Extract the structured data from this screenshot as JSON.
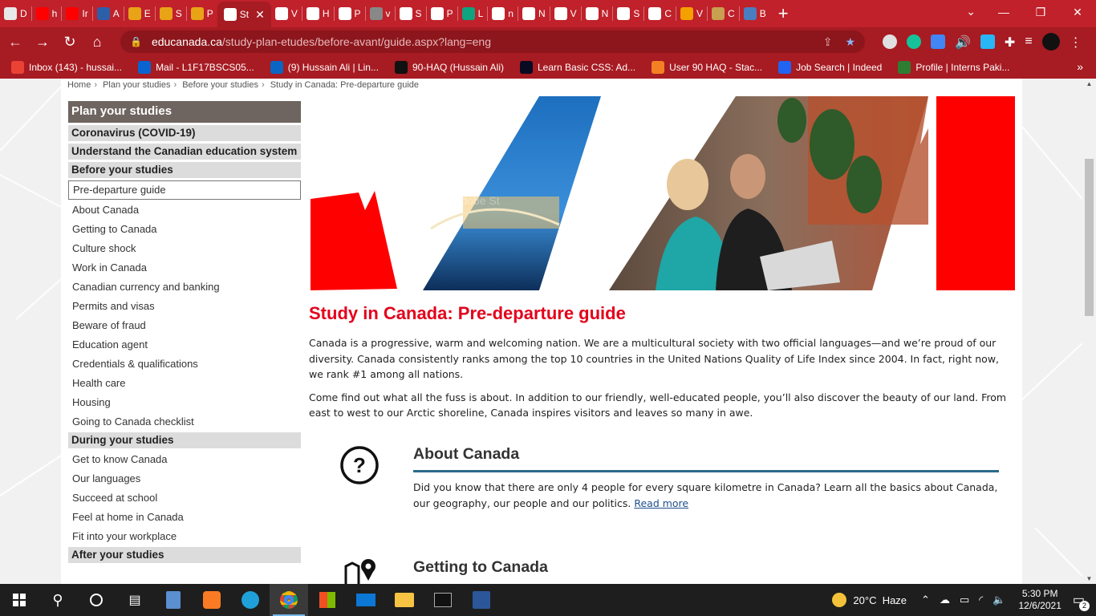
{
  "browser": {
    "tabs": [
      {
        "label": "D",
        "color": "#e8e8e8"
      },
      {
        "label": "h",
        "color": "#ff0000"
      },
      {
        "label": "Ir",
        "color": "#ff0000"
      },
      {
        "label": "A",
        "color": "#2d5fa8"
      },
      {
        "label": "E",
        "color": "#e8a317"
      },
      {
        "label": "S",
        "color": "#e8a317"
      },
      {
        "label": "P",
        "color": "#e8a317"
      },
      {
        "label": "St",
        "color": "#ffffff",
        "active": true
      },
      {
        "label": "V",
        "color": "#ffffff"
      },
      {
        "label": "H",
        "color": "#ffffff"
      },
      {
        "label": "P",
        "color": "#ffffff"
      },
      {
        "label": "v",
        "color": "#888888"
      },
      {
        "label": "S",
        "color": "#ffffff"
      },
      {
        "label": "P",
        "color": "#ffffff"
      },
      {
        "label": "L",
        "color": "#10a37f"
      },
      {
        "label": "n",
        "color": "#ffffff"
      },
      {
        "label": "N",
        "color": "#ffffff"
      },
      {
        "label": "V",
        "color": "#ffffff"
      },
      {
        "label": "N",
        "color": "#ffffff"
      },
      {
        "label": "S",
        "color": "#ffffff"
      },
      {
        "label": "C",
        "color": "#ffffff"
      },
      {
        "label": "V",
        "color": "#f4a000"
      },
      {
        "label": "C",
        "color": "#c8a050"
      },
      {
        "label": "B",
        "color": "#4a7ec0"
      }
    ],
    "active_tab_close": "✕",
    "new_tab": "+",
    "url_host": "educanada.ca",
    "url_path": "/study-plan-etudes/before-avant/guide.aspx?lang=eng",
    "bookmarks": [
      {
        "label": "Inbox (143) - hussai...",
        "icon": "gmail-icon",
        "color": "#ea4335"
      },
      {
        "label": "Mail - L1F17BSCS05...",
        "icon": "outlook-icon",
        "color": "#0a64d0"
      },
      {
        "label": "(9) Hussain Ali | Lin...",
        "icon": "linkedin-icon",
        "color": "#0a66c2"
      },
      {
        "label": "90-HAQ (Hussain Ali)",
        "icon": "github-icon",
        "color": "#111111"
      },
      {
        "label": "Learn Basic CSS: Ad...",
        "icon": "freecodecamp-icon",
        "color": "#0a0a23"
      },
      {
        "label": "User 90 HAQ - Stac...",
        "icon": "stackoverflow-icon",
        "color": "#f48024"
      },
      {
        "label": "Job Search | Indeed",
        "icon": "indeed-icon",
        "color": "#2164f3"
      },
      {
        "label": "Profile | Interns Paki...",
        "icon": "interns-icon",
        "color": "#2e7d32"
      }
    ]
  },
  "breadcrumb": [
    "Home",
    "Plan your studies",
    "Before your studies",
    "Study in Canada: Pre-departure guide"
  ],
  "sidebar": {
    "title": "Plan your studies",
    "sections": [
      {
        "label": "Coronavirus (COVID-19)",
        "items": []
      },
      {
        "label": "Understand the Canadian education system",
        "items": []
      },
      {
        "label": "Before your studies",
        "items": [
          "Pre-departure guide",
          "About Canada",
          "Getting to Canada",
          "Culture shock",
          "Work in Canada",
          "Canadian currency and banking",
          "Permits and visas",
          "Beware of fraud",
          "Education agent",
          "Credentials & qualifications",
          "Health care",
          "Housing",
          "Going to Canada checklist"
        ]
      },
      {
        "label": "During your studies",
        "items": [
          "Get to know Canada",
          "Our languages",
          "Succeed at school",
          "Feel at home in Canada",
          "Fit into your workplace"
        ]
      },
      {
        "label": "After your studies",
        "items": []
      }
    ],
    "current": "Pre-departure guide"
  },
  "hero": {
    "watermark": "Adobe St"
  },
  "main": {
    "title": "Study in Canada: Pre-departure guide",
    "paragraphs": [
      "Canada is a progressive, warm and welcoming nation. We are a multicultural society with two official languages—and we’re proud of our diversity. Canada consistently ranks among the top 10 countries in the United Nations Quality of Life Index since 2004. In fact, right now, we rank #1 among all nations.",
      "Come find out what all the fuss is about. In addition to our friendly, well-educated people, you’ll also discover the beauty of our land. From east to west to our Arctic shoreline, Canada inspires visitors and leaves so many in awe."
    ],
    "topics": [
      {
        "title": "About Canada",
        "body": "Did you know that there are only 4 people for every square kilometre in Canada? Learn all the basics about Canada, our geography, our people and our politics.",
        "link": "Read more",
        "icon": "question-circle-icon"
      },
      {
        "title": "Getting to Canada",
        "icon": "map-pin-icon"
      }
    ]
  },
  "taskbar": {
    "weather": "20°C  Haze",
    "time": "5:30 PM",
    "date": "12/6/2021",
    "notifications": "2"
  },
  "colors": {
    "browser_red": "#c0212a",
    "accent_red": "#e3001b",
    "sidebar_title_bg": "#6e6460",
    "section_bg": "#dcdcdc",
    "topic_rule": "#2a6b8a"
  }
}
